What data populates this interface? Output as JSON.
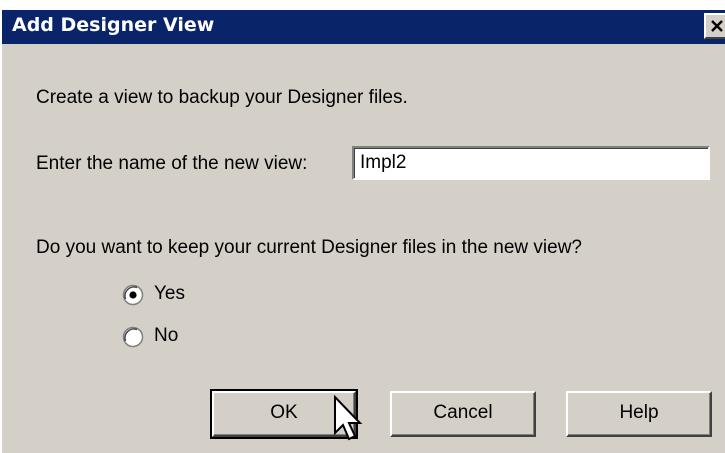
{
  "dialog": {
    "title": "Add Designer View",
    "close_icon": "close-icon",
    "intro_text": "Create a view to backup your Designer files.",
    "name_label": "Enter the name of the new view:",
    "name_value": "Impl2",
    "question_text": "Do you want to keep your current Designer files in the new view?",
    "options": [
      {
        "label": "Yes",
        "selected": true
      },
      {
        "label": "No",
        "selected": false
      }
    ],
    "buttons": {
      "ok": "OK",
      "cancel": "Cancel",
      "help": "Help"
    }
  },
  "colors": {
    "titlebar": "#0a246a",
    "face": "#d4d0c8"
  },
  "pointer": "arrow-cursor-icon"
}
